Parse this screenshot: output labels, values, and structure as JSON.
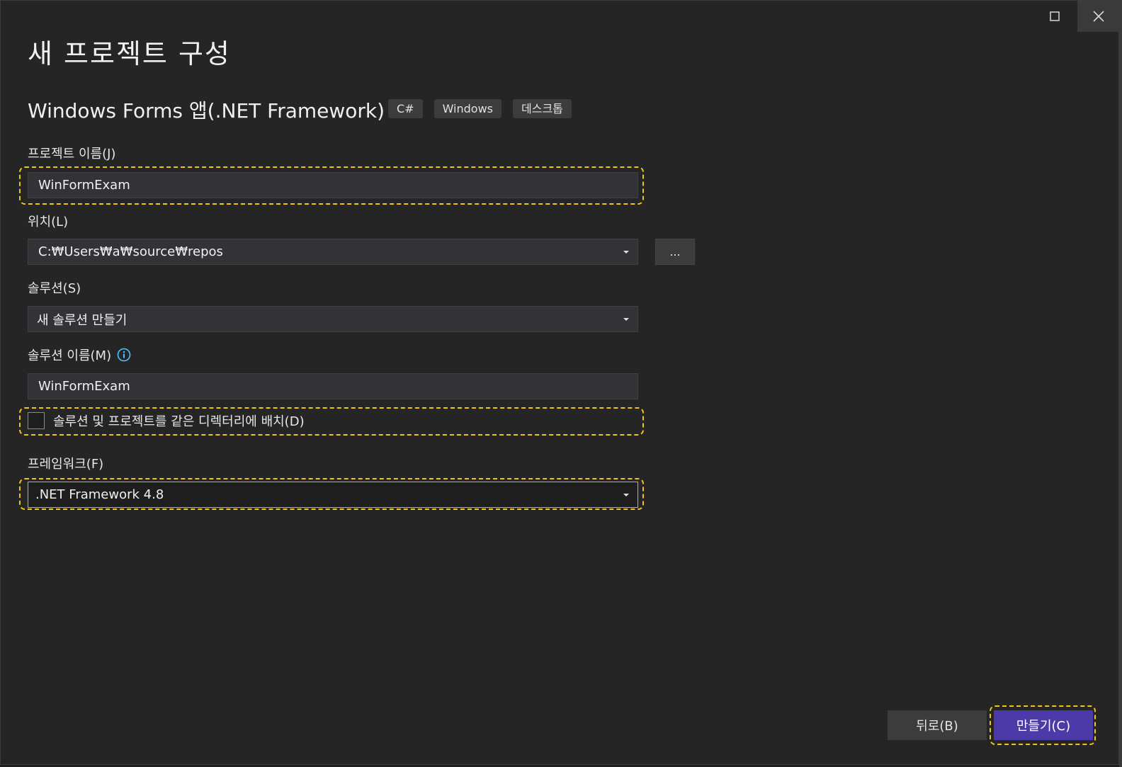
{
  "window": {
    "title": "새 프로젝트 구성"
  },
  "template": {
    "name": "Windows Forms 앱(.NET Framework)",
    "tags": [
      "C#",
      "Windows",
      "데스크톱"
    ]
  },
  "form": {
    "project_name_label": "프로젝트 이름(J)",
    "project_name_value": "WinFormExam",
    "location_label": "위치(L)",
    "location_value": "C:₩Users₩a₩source₩repos",
    "browse_label": "...",
    "solution_label": "솔루션(S)",
    "solution_value": "새 솔루션 만들기",
    "solution_name_label": "솔루션 이름(M)",
    "solution_name_value": "WinFormExam",
    "same_dir_label": "솔루션 및 프로젝트를 같은 디렉터리에 배치(D)",
    "same_dir_checked": false,
    "framework_label": "프레임워크(F)",
    "framework_value": ".NET Framework 4.8"
  },
  "footer": {
    "back_label": "뒤로(B)",
    "create_label": "만들기(C)"
  },
  "colors": {
    "highlight": "#f0c419",
    "primary_button": "#4b3aa8",
    "info_icon": "#4fc1ff"
  }
}
